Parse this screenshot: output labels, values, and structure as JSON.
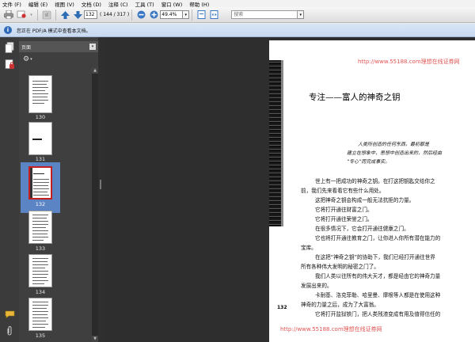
{
  "menu": [
    "文件 (F)",
    "编辑 (E)",
    "视图 (V)",
    "文档 (D)",
    "注释 (C)",
    "工具 (T)",
    "窗口 (W)",
    "帮助 (H)"
  ],
  "toolbar": {
    "page_current": "132",
    "page_total": "( 144 / 317 )",
    "zoom": "49.4%",
    "search_placeholder": "搜索"
  },
  "infobar": {
    "message": "您正在 PDF/A 模式中查看本文档。"
  },
  "panel": {
    "title": "页面"
  },
  "thumbnails": [
    {
      "label": "130"
    },
    {
      "label": "131"
    },
    {
      "label": "132"
    },
    {
      "label": "133"
    },
    {
      "label": "134"
    },
    {
      "label": "135"
    }
  ],
  "document": {
    "watermark": "http://www.55188.com理想在线证券网",
    "chapter_title": "专注——富人的神奇之钥",
    "epigraph": [
      "人类所创造的任何东西，最初都是",
      "建立在想象中，思想中创造出来的，然后经由",
      "“专心”而完成事实。"
    ],
    "body": [
      "世上有一把成功的神奇之钥。在打这把钥匙交给你之",
      "前，我们先来看看它有些什么用处。",
      "这把神奇之钥会构成一般无法抗拒的力量。",
      "它将打开通往财富之门。",
      "它将打开通往荣誉之门。",
      "在很多情况下，它会打开通往健康之门。",
      "它也将打开通往教育之门，让你进入你所有潜在能力的",
      "宝库。",
      "在这把“神奇之钥”的协助下，我们已经打开通往世界",
      "所有各种伟大发明的秘密之门了。",
      "我们人类以往所有的伟大天才，都是经由它的神奇力量",
      "发展出来的。",
      "卡耐基、洛克菲勒、哈里曼、摩根等人都是在使用这种",
      "神奇的力量之后，成为了大富翁。",
      "它将打开监狱铁门，把人类残渣变成有用及值得信任的"
    ],
    "page_number": "132"
  },
  "colors": {
    "accent": "#2d6db5",
    "selection": "#5b84c4",
    "current_border": "#c41e1e",
    "watermark": "#e05555"
  }
}
